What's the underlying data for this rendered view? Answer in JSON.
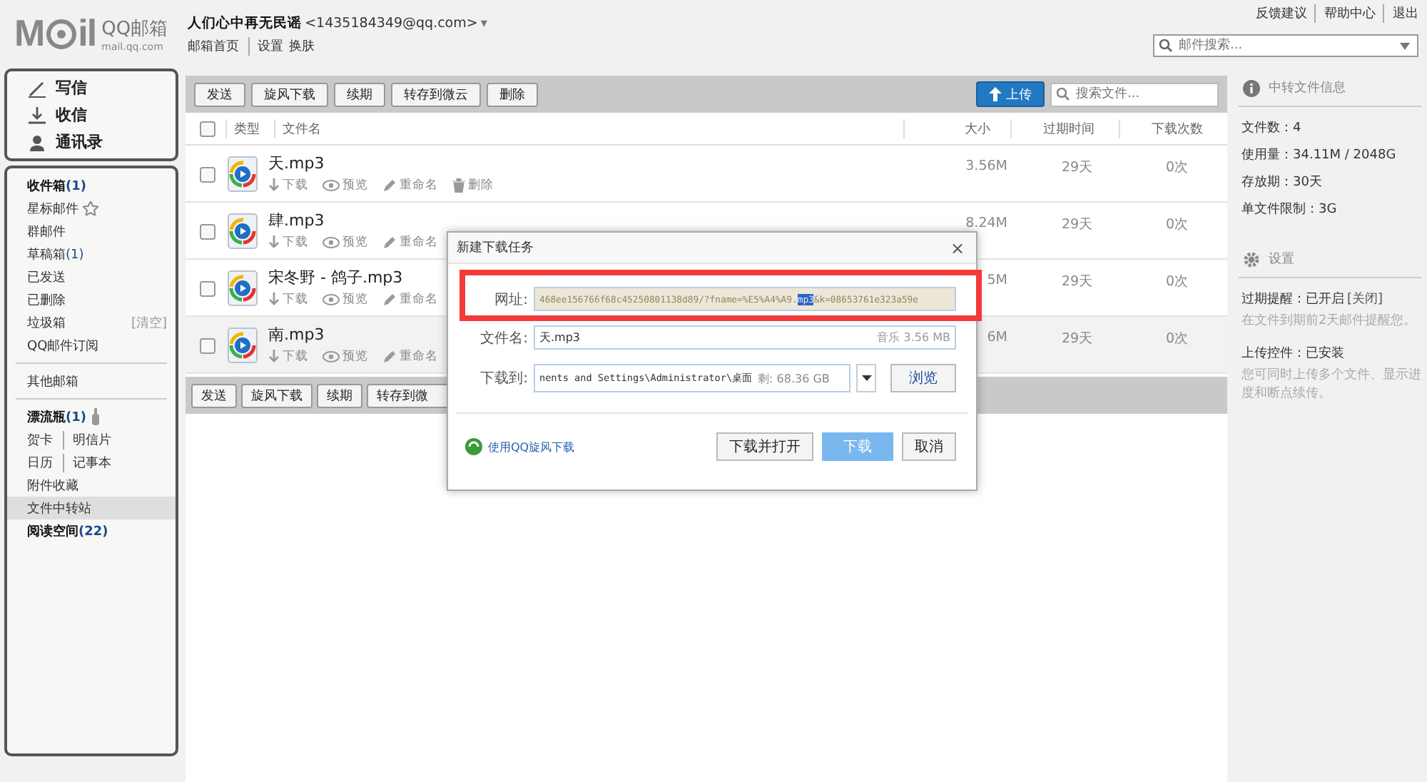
{
  "header": {
    "logo_mark": [
      "M",
      "il"
    ],
    "logo_text": "QQ邮箱",
    "logo_sub": "mail.qq.com",
    "user_name": "人们心中再无民谣",
    "user_email": "<1435184349@qq.com>",
    "caret": "▾",
    "links": [
      "邮箱首页",
      "设置",
      "换肤"
    ],
    "top_links": [
      "反馈建议",
      "帮助中心",
      "退出"
    ],
    "search": {
      "placeholder": "邮件搜索..."
    }
  },
  "sidebar": {
    "actions": [
      {
        "label": "写信",
        "kind": "write"
      },
      {
        "label": "收信",
        "kind": "receive"
      },
      {
        "label": "通讯录",
        "kind": "contacts"
      }
    ],
    "groups": [
      [
        {
          "label": "收件箱",
          "count": "(1)",
          "bold": true,
          "selected": false
        },
        {
          "label": "星标邮件",
          "kind": "starred",
          "selected": false
        },
        {
          "label": "群邮件",
          "selected": false
        },
        {
          "label": "草稿箱",
          "count": "(1)",
          "selected": false
        },
        {
          "label": "已发送",
          "selected": false
        },
        {
          "label": "已删除",
          "selected": false
        },
        {
          "label": "垃圾箱",
          "extra": "[清空]",
          "selected": false
        },
        {
          "label": "QQ邮件订阅",
          "selected": false
        }
      ],
      [
        {
          "label": "其他邮箱",
          "selected": false
        }
      ],
      [
        {
          "label": "漂流瓶",
          "count": "(1)",
          "bold": true,
          "kind": "bottle",
          "selected": false
        },
        {
          "kind": "pair",
          "labels": [
            "贺卡",
            "明信片"
          ],
          "selected": false
        },
        {
          "kind": "pair",
          "labels": [
            "日历",
            "记事本"
          ],
          "selected": false
        },
        {
          "label": "附件收藏",
          "selected": false
        },
        {
          "label": "文件中转站",
          "selected": true
        },
        {
          "label": "阅读空间",
          "count": "(22)",
          "bold": true,
          "selected": false
        }
      ]
    ]
  },
  "toolbar": {
    "buttons": [
      "发送",
      "旋风下载",
      "续期",
      "转存到微云",
      "删除"
    ],
    "upload": "上传",
    "search": {
      "placeholder": "搜索文件..."
    }
  },
  "table": {
    "select_all": {
      "checked": false
    },
    "columns": [
      "类型",
      "文件名",
      "大小",
      "过期时间",
      "下载次数"
    ],
    "rows": [
      {
        "name": "天.mp3",
        "actions": [
          "下载",
          "预览",
          "重命名",
          "删除"
        ],
        "size": "3.56M",
        "expiry": "29天",
        "downloads": "0次",
        "checked": false,
        "selected": false
      },
      {
        "name": "肆.mp3",
        "actions": [
          "下载",
          "预览",
          "重命名"
        ],
        "size": "8.24M",
        "expiry": "29天",
        "downloads": "0次",
        "checked": false,
        "selected": false
      },
      {
        "name": "宋冬野 - 鸽子.mp3",
        "actions": [
          "下载",
          "预览",
          "重命名"
        ],
        "size": "5M",
        "expiry": "29天",
        "downloads": "0次",
        "checked": false,
        "selected": false
      },
      {
        "name": "南.mp3",
        "actions": [
          "下载",
          "预览",
          "重命名"
        ],
        "size": "6M",
        "expiry": "29天",
        "downloads": "0次",
        "checked": false,
        "selected": true
      }
    ]
  },
  "bottom_toolbar": {
    "buttons": [
      "发送",
      "旋风下载",
      "续期",
      "转存到微"
    ]
  },
  "dialog": {
    "title": "新建下载任务",
    "close": "×",
    "url_label": "网址:",
    "url": {
      "before": "468ee156766f68c45250801138d89/?fname=%E5%A4%A9.",
      "selected": "mp3",
      "after": "&k=08653761e323a59e"
    },
    "name_label": "文件名:",
    "name_value": "天.mp3",
    "name_meta": "音乐 3.56 MB",
    "path_label": "下载到:",
    "path_value": "nents and Settings\\Administrator\\桌面",
    "path_free": "剩: 68.36 GB",
    "browse": "浏览",
    "link": "使用QQ旋风下载",
    "buttons": [
      {
        "label": "下载并打开",
        "kind": "normal"
      },
      {
        "label": "下载",
        "kind": "primary"
      },
      {
        "label": "取消",
        "kind": "normal"
      }
    ]
  },
  "info_panel": {
    "title": "中转文件信息",
    "stats": [
      "文件数：4",
      "使用量：34.11M / 2048G",
      "存放期：30天",
      "单文件限制：3G"
    ],
    "settings_title": "设置",
    "settings": [
      {
        "label": "过期提醒：已开启",
        "link": "[关闭]",
        "desc": "在文件到期前2天邮件提醒您。"
      },
      {
        "label": "上传控件：已安装",
        "desc": "您可同时上传多个文件、显示进度和断点续传。"
      }
    ]
  }
}
